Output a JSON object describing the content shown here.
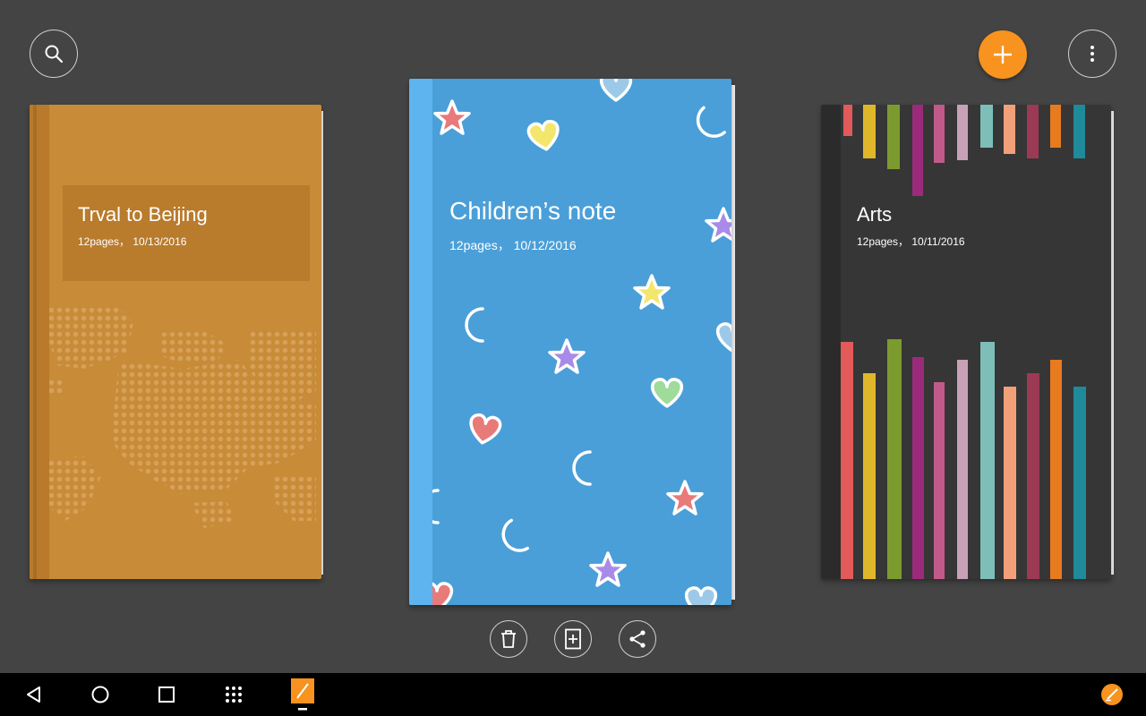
{
  "toolbar": {
    "search_icon": "search-icon",
    "add_icon": "plus-icon",
    "more_icon": "more-vertical-icon",
    "accent_color": "#f7931e"
  },
  "notebooks": [
    {
      "title": "Trval to Beijing",
      "meta": "12pages， 10/13/2016",
      "cover_color": "#c88b38"
    },
    {
      "title": "Children’s note",
      "meta": "12pages， 10/12/2016",
      "cover_color": "#4a9fd8"
    },
    {
      "title": "Arts",
      "meta": "12pages， 10/11/2016",
      "cover_color": "#363636"
    }
  ],
  "actions": {
    "delete_icon": "trash-icon",
    "add_page_icon": "add-page-icon",
    "share_icon": "share-icon"
  },
  "navbar": {
    "back_icon": "back-icon",
    "home_icon": "home-icon",
    "recents_icon": "recents-icon",
    "apps_icon": "apps-grid-icon",
    "active_app_icon": "notebook-app-icon",
    "tray_icon": "notebook-tray-icon"
  }
}
